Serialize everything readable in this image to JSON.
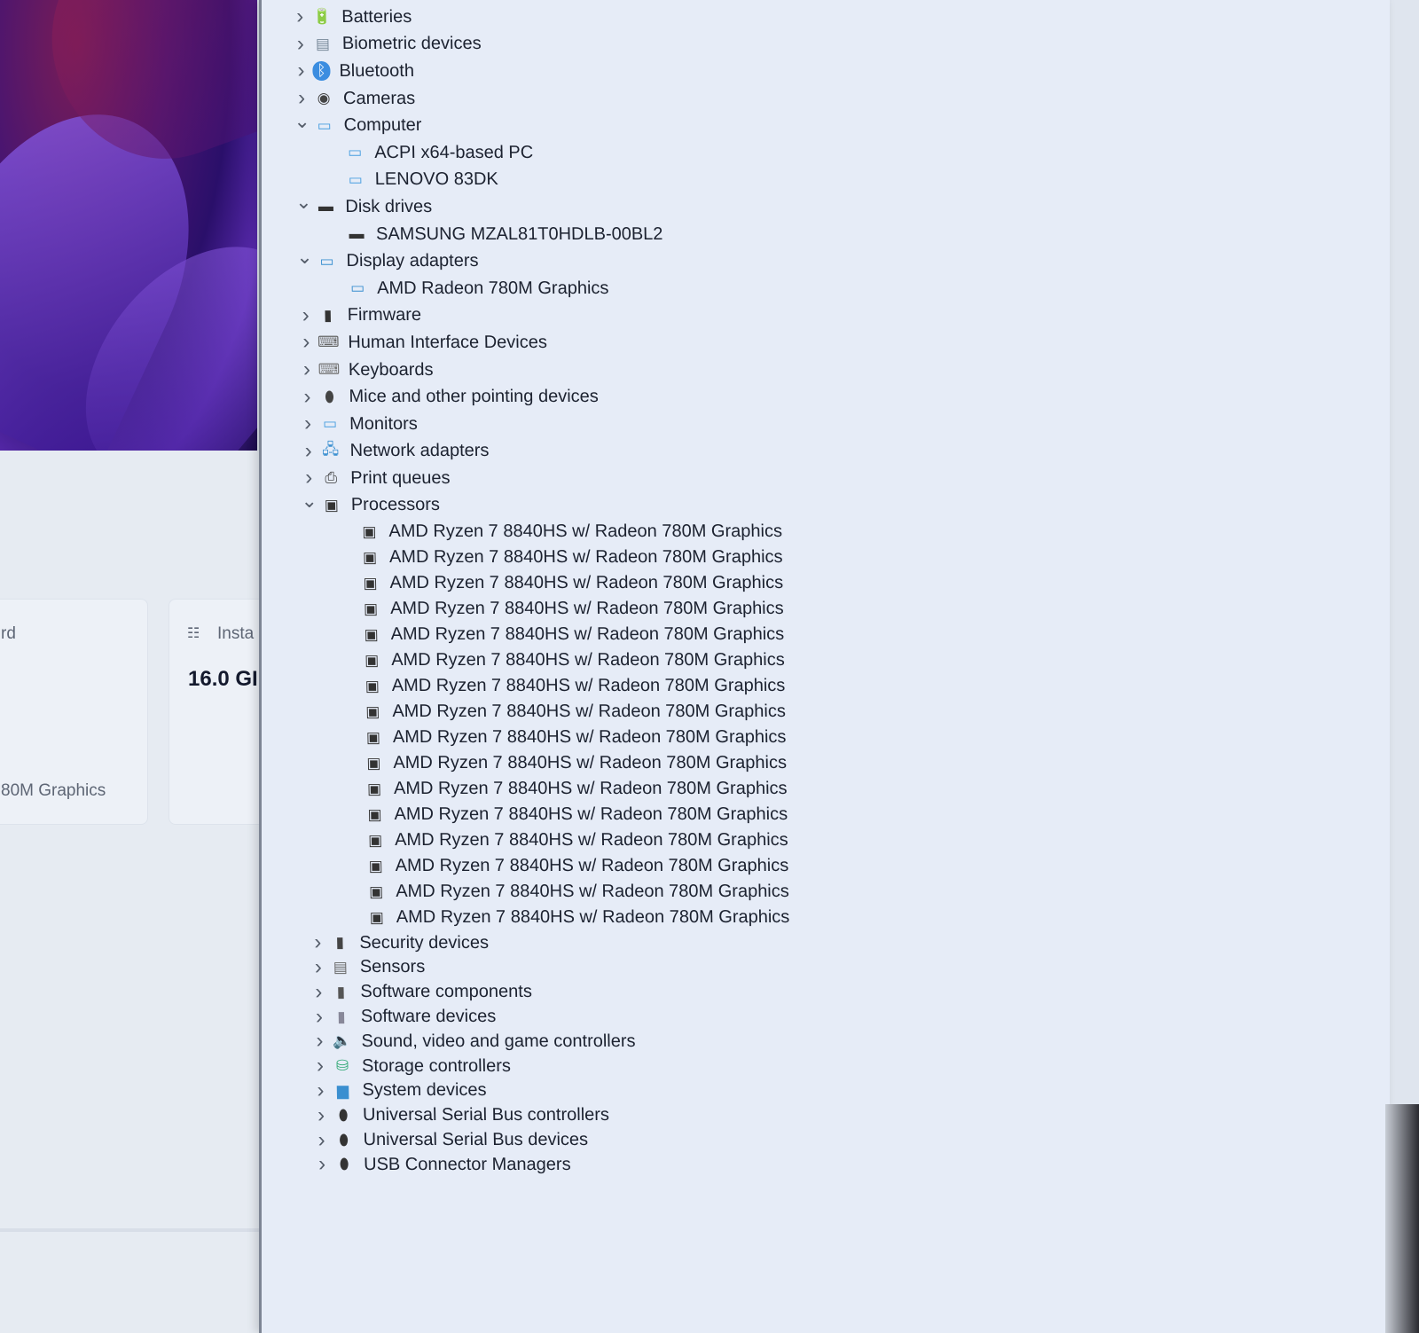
{
  "background_panel": {
    "card1_heading_fragment": "rd",
    "card1_value_fragment": "80M Graphics",
    "card2_heading_fragment": "Insta",
    "card2_value_fragment": "16.0 GI",
    "card2_icon": "memory-icon"
  },
  "device_tree": [
    {
      "label": "Batteries",
      "level": 0,
      "expanded": false,
      "icon": "battery-icon"
    },
    {
      "label": "Biometric devices",
      "level": 0,
      "expanded": false,
      "icon": "fingerprint-icon"
    },
    {
      "label": "Bluetooth",
      "level": 0,
      "expanded": false,
      "icon": "bluetooth-icon"
    },
    {
      "label": "Cameras",
      "level": 0,
      "expanded": false,
      "icon": "camera-icon"
    },
    {
      "label": "Computer",
      "level": 0,
      "expanded": true,
      "icon": "computer-icon"
    },
    {
      "label": "ACPI x64-based PC",
      "level": 1,
      "icon": "computer-icon"
    },
    {
      "label": "LENOVO 83DK",
      "level": 1,
      "icon": "computer-icon"
    },
    {
      "label": "Disk drives",
      "level": 0,
      "expanded": true,
      "icon": "disk-drive-icon"
    },
    {
      "label": "SAMSUNG MZAL81T0HDLB-00BL2",
      "level": 1,
      "icon": "disk-drive-icon"
    },
    {
      "label": "Display adapters",
      "level": 0,
      "expanded": true,
      "icon": "display-adapter-icon"
    },
    {
      "label": "AMD Radeon 780M Graphics",
      "level": 1,
      "icon": "display-adapter-icon"
    },
    {
      "label": "Firmware",
      "level": 0,
      "expanded": false,
      "icon": "firmware-icon"
    },
    {
      "label": "Human Interface Devices",
      "level": 0,
      "expanded": false,
      "icon": "hid-icon"
    },
    {
      "label": "Keyboards",
      "level": 0,
      "expanded": false,
      "icon": "keyboard-icon"
    },
    {
      "label": "Mice and other pointing devices",
      "level": 0,
      "expanded": false,
      "icon": "mouse-icon"
    },
    {
      "label": "Monitors",
      "level": 0,
      "expanded": false,
      "icon": "monitor-icon"
    },
    {
      "label": "Network adapters",
      "level": 0,
      "expanded": false,
      "icon": "network-icon"
    },
    {
      "label": "Print queues",
      "level": 0,
      "expanded": false,
      "icon": "printer-icon"
    },
    {
      "label": "Processors",
      "level": 0,
      "expanded": true,
      "icon": "processor-icon"
    },
    {
      "label": "AMD Ryzen 7 8840HS w/ Radeon 780M Graphics",
      "level": 1,
      "icon": "processor-icon"
    },
    {
      "label": "AMD Ryzen 7 8840HS w/ Radeon 780M Graphics",
      "level": 1,
      "icon": "processor-icon"
    },
    {
      "label": "AMD Ryzen 7 8840HS w/ Radeon 780M Graphics",
      "level": 1,
      "icon": "processor-icon"
    },
    {
      "label": "AMD Ryzen 7 8840HS w/ Radeon 780M Graphics",
      "level": 1,
      "icon": "processor-icon"
    },
    {
      "label": "AMD Ryzen 7 8840HS w/ Radeon 780M Graphics",
      "level": 1,
      "icon": "processor-icon"
    },
    {
      "label": "AMD Ryzen 7 8840HS w/ Radeon 780M Graphics",
      "level": 1,
      "icon": "processor-icon"
    },
    {
      "label": "AMD Ryzen 7 8840HS w/ Radeon 780M Graphics",
      "level": 1,
      "icon": "processor-icon"
    },
    {
      "label": "AMD Ryzen 7 8840HS w/ Radeon 780M Graphics",
      "level": 1,
      "icon": "processor-icon"
    },
    {
      "label": "AMD Ryzen 7 8840HS w/ Radeon 780M Graphics",
      "level": 1,
      "icon": "processor-icon"
    },
    {
      "label": "AMD Ryzen 7 8840HS w/ Radeon 780M Graphics",
      "level": 1,
      "icon": "processor-icon"
    },
    {
      "label": "AMD Ryzen 7 8840HS w/ Radeon 780M Graphics",
      "level": 1,
      "icon": "processor-icon"
    },
    {
      "label": "AMD Ryzen 7 8840HS w/ Radeon 780M Graphics",
      "level": 1,
      "icon": "processor-icon"
    },
    {
      "label": "AMD Ryzen 7 8840HS w/ Radeon 780M Graphics",
      "level": 1,
      "icon": "processor-icon"
    },
    {
      "label": "AMD Ryzen 7 8840HS w/ Radeon 780M Graphics",
      "level": 1,
      "icon": "processor-icon"
    },
    {
      "label": "AMD Ryzen 7 8840HS w/ Radeon 780M Graphics",
      "level": 1,
      "icon": "processor-icon"
    },
    {
      "label": "AMD Ryzen 7 8840HS w/ Radeon 780M Graphics",
      "level": 1,
      "icon": "processor-icon"
    },
    {
      "label": "Security devices",
      "level": 0,
      "expanded": false,
      "icon": "security-icon"
    },
    {
      "label": "Sensors",
      "level": 0,
      "expanded": false,
      "icon": "sensor-icon"
    },
    {
      "label": "Software components",
      "level": 0,
      "expanded": false,
      "icon": "software-component-icon"
    },
    {
      "label": "Software devices",
      "level": 0,
      "expanded": false,
      "icon": "software-device-icon"
    },
    {
      "label": "Sound, video and game controllers",
      "level": 0,
      "expanded": false,
      "icon": "speaker-icon"
    },
    {
      "label": "Storage controllers",
      "level": 0,
      "expanded": false,
      "icon": "storage-controller-icon"
    },
    {
      "label": "System devices",
      "level": 0,
      "expanded": false,
      "icon": "system-folder-icon"
    },
    {
      "label": "Universal Serial Bus controllers",
      "level": 0,
      "expanded": false,
      "icon": "usb-icon"
    },
    {
      "label": "Universal Serial Bus devices",
      "level": 0,
      "expanded": false,
      "icon": "usb-icon"
    },
    {
      "label": "USB Connector Managers",
      "level": 0,
      "expanded": false,
      "icon": "usb-icon"
    }
  ]
}
